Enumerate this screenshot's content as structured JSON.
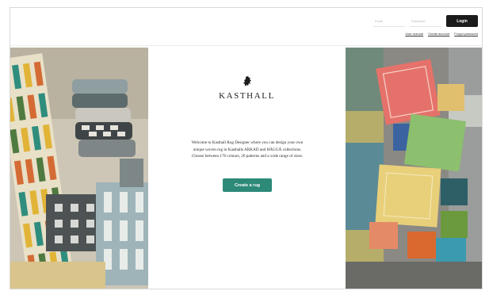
{
  "header": {
    "email_placeholder": "Email",
    "password_placeholder": "Password",
    "login_label": "Login",
    "links": [
      "User manual",
      "Create account",
      "Forgot password"
    ]
  },
  "brand": {
    "name": "KASTHALL",
    "logo_icon": "rampant-lion-icon"
  },
  "main": {
    "welcome_text": "Welcome to Kasthall Rug Designer where you can design your own unique woven rug in Kasthalls ARKAD and HÄGGÅ collections. Choose between 176 colours, 20 patterns and a wide range of sizes.",
    "create_label": "Create a rug"
  },
  "colors": {
    "accent": "#2d8a79",
    "login_button": "#1b1b1b"
  }
}
